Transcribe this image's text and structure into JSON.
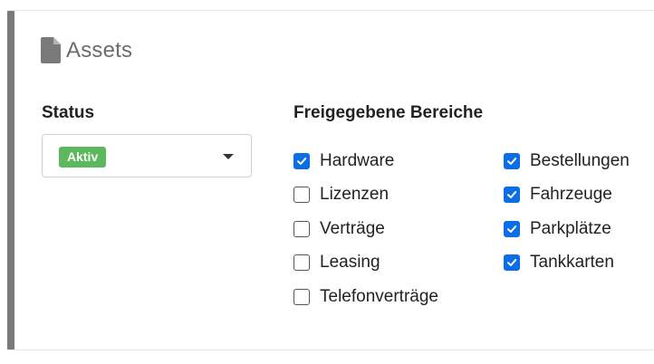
{
  "panel": {
    "title": "Assets",
    "title_icon": "file-icon"
  },
  "status": {
    "label": "Status",
    "selected_value": "Aktiv",
    "badge_color": "#5cb85c"
  },
  "areas": {
    "label": "Freigegebene Bereiche",
    "checkbox_color": "#0b6ee6",
    "left_column": [
      {
        "label": "Hardware",
        "checked": true
      },
      {
        "label": "Lizenzen",
        "checked": false
      },
      {
        "label": "Verträge",
        "checked": false
      },
      {
        "label": "Leasing",
        "checked": false
      },
      {
        "label": "Telefonverträge",
        "checked": false
      }
    ],
    "right_column": [
      {
        "label": "Bestellungen",
        "checked": true
      },
      {
        "label": "Fahrzeuge",
        "checked": true
      },
      {
        "label": "Parkplätze",
        "checked": true
      },
      {
        "label": "Tankkarten",
        "checked": true
      }
    ]
  }
}
